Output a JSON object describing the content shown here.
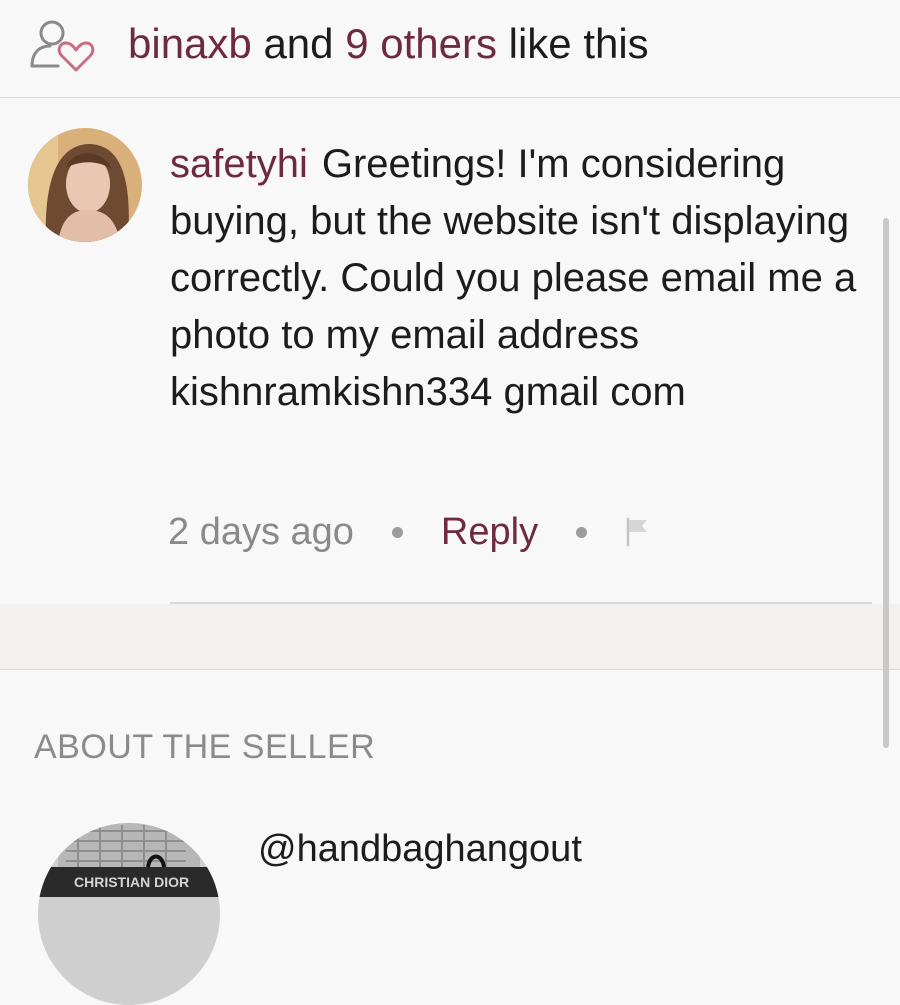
{
  "likes": {
    "icon": "user-heart-icon",
    "user": "binaxb",
    "connector": "and",
    "others": "9 others",
    "suffix": "like this"
  },
  "comment": {
    "avatar": "commenter-avatar",
    "username": "safetyhi",
    "text": "Greetings! I'm considering buying, but the website isn't displaying correctly. Could you please email me a photo to my email address kishnramkishn334 gmail com",
    "timestamp": "2 days ago",
    "reply_label": "Reply",
    "flag_icon": "flag-icon"
  },
  "seller": {
    "heading": "ABOUT THE SELLER",
    "handle": "@handbaghangout",
    "avatar_text": "CHRISTIAN DIOR"
  },
  "colors": {
    "accent": "#6e2a3e",
    "text": "#1c1c1c",
    "muted": "#8a8a8a",
    "divider": "#dcdbdb",
    "background": "#f9f8f8",
    "band": "#f2f1ef"
  }
}
